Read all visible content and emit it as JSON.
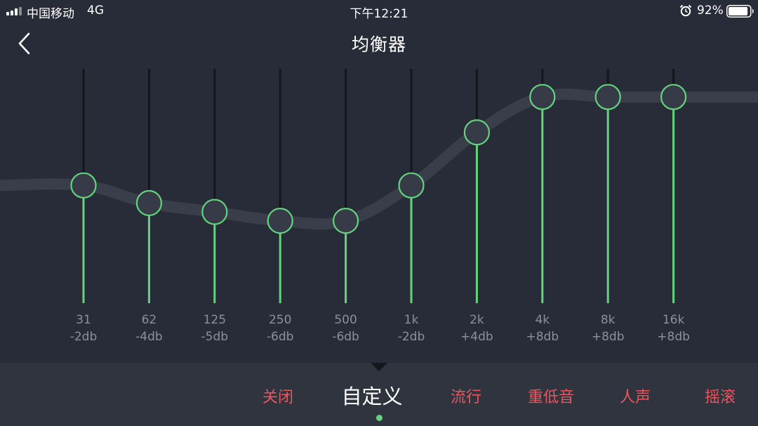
{
  "status_bar": {
    "carrier": "中国移动",
    "network": "4G",
    "time": "下午12:21",
    "battery_percent": "92%",
    "battery_level": 0.92,
    "icons": [
      "signal-icon",
      "alarm-icon",
      "battery-icon"
    ]
  },
  "header": {
    "title": "均衡器",
    "back_icon": "chevron-left-icon"
  },
  "equalizer": {
    "db_range": [
      -12,
      12
    ],
    "bands": [
      {
        "freq": "31",
        "gain_label": "-2db",
        "gain": -2
      },
      {
        "freq": "62",
        "gain_label": "-4db",
        "gain": -4
      },
      {
        "freq": "125",
        "gain_label": "-5db",
        "gain": -5
      },
      {
        "freq": "250",
        "gain_label": "-6db",
        "gain": -6
      },
      {
        "freq": "500",
        "gain_label": "-6db",
        "gain": -6
      },
      {
        "freq": "1k",
        "gain_label": "-2db",
        "gain": -2
      },
      {
        "freq": "2k",
        "gain_label": "+4db",
        "gain": 4
      },
      {
        "freq": "4k",
        "gain_label": "+8db",
        "gain": 8
      },
      {
        "freq": "8k",
        "gain_label": "+8db",
        "gain": 8
      },
      {
        "freq": "16k",
        "gain_label": "+8db",
        "gain": 8
      }
    ]
  },
  "presets": {
    "items": [
      "关闭",
      "自定义",
      "流行",
      "重低音",
      "人声",
      "摇滚"
    ],
    "active_index": 1
  },
  "colors": {
    "background": "#282c38",
    "track_filled": "#63d37c",
    "track_empty": "#14161b",
    "curve": "#3a3e4a",
    "knob_fill": "#373b48",
    "preset_text": "#e9565e",
    "preset_active": "#ffffff",
    "preset_bar": "#30343f"
  }
}
